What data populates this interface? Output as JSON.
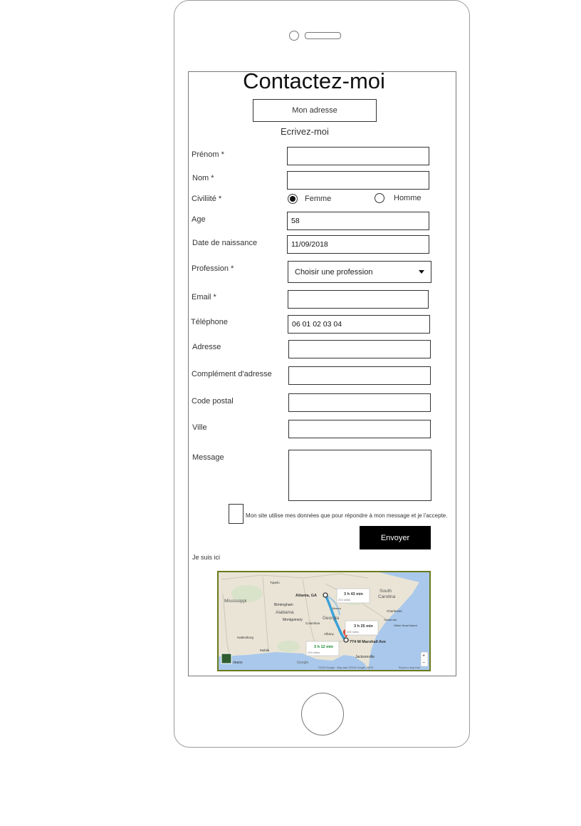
{
  "page": {
    "title": "Contactez-moi"
  },
  "buttons": {
    "address": "Mon adresse",
    "send": "Envoyer"
  },
  "subtitle": "Ecrivez-moi",
  "form": {
    "firstname_label": "Prénom *",
    "lastname_label": "Nom *",
    "civility_label": "Civiliité *",
    "civility_options": [
      "Femme",
      "Homme"
    ],
    "civility_selected": "Femme",
    "age_label": "Age",
    "age_value": "58",
    "birthdate_label": "Date de naissance",
    "birthdate_value": "11/09/2018",
    "profession_label": "Profession *",
    "profession_value": "Choisir une profession",
    "email_label": "Email *",
    "phone_label": "Téléphone",
    "phone_value": "06 01 02 03 04",
    "address_label": "Adresse",
    "address2_label": "Complément d'adresse",
    "zip_label": "Code postal",
    "city_label": "Ville",
    "message_label": "Message",
    "consent_text": "Mon site utilise mes données que pour répondre à mon message et je l'accepte."
  },
  "map": {
    "label": "Je suis ici",
    "places": {
      "atlanta": "Atlanta, GA",
      "destination": "774 W Marshall Ave",
      "mississippi": "Mississippi",
      "alabama": "Alabama",
      "birmingham": "Birmingham",
      "montgomery": "Montgomery",
      "georgia": "Georgia",
      "south_carolina_1": "South",
      "south_carolina_2": "Carolina",
      "charleston": "Charleston",
      "jacksonville": "Jacksonville",
      "tupelo": "Tupelo",
      "columbus": "Columbus",
      "albany": "Albany",
      "mobile": "Mobile",
      "hattiesburg": "Hattiesburg",
      "orleans": "rleans",
      "macon": "Macon",
      "savannah": "Savannah",
      "hilton_head": "Hilton Head Island"
    },
    "routes": [
      {
        "time": "3 h 43 min",
        "dist": "223 miles"
      },
      {
        "time": "3 h 25 min",
        "dist": "205 miles"
      },
      {
        "time": "3 h 12 min",
        "dist": "209 miles"
      }
    ],
    "footer": "©2016 Google · Map data ©2016 Google, INEGI",
    "report": "Report a map error",
    "brand": "Google",
    "zoom_in": "+",
    "zoom_out": "−",
    "colors": {
      "land": "#e9e4d6",
      "water": "#a9c8ec",
      "route": "#3aa1d9",
      "marker": "#d9402f"
    }
  }
}
